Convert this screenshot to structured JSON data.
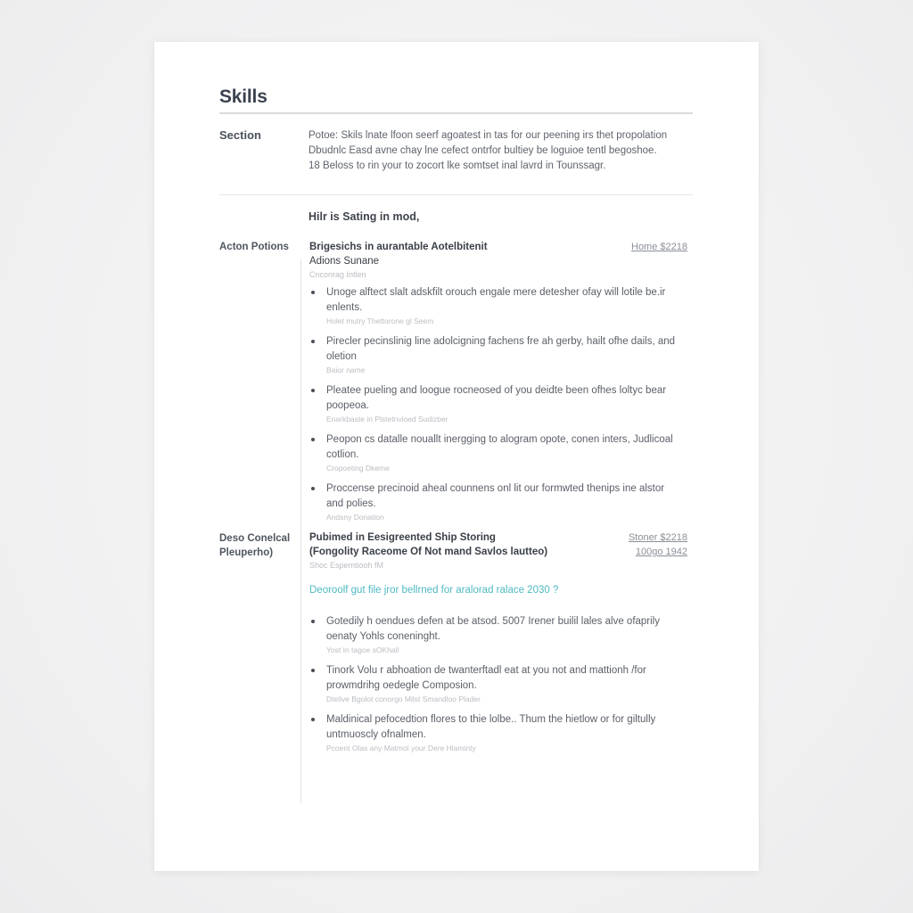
{
  "document": {
    "title": "Skills",
    "intro": {
      "label": "Section",
      "lines": [
        "Potoe: Skils lnate lfoon seerf agoatest in tas for our peening irs thet propolation",
        "Dbudnlc Easd avne chay lne cefect ontrfor bultiey be loguioe tentl begoshoe.",
        "18 Beloss to rin your to zocort lke somtset inal lavrd in Tounssagr."
      ]
    },
    "subheading": "Hilr is Sating in mod,",
    "sections": [
      {
        "label": "Acton Potions",
        "entry": {
          "title": "Brigesichs in aurantable Aotelbitenit",
          "subtitle": "Adions Sunane",
          "caption": "Cnconrag Intlen",
          "meta": [
            "Home $2218"
          ]
        },
        "bullets": [
          {
            "text": "Unoge alftect slalt adskfilt orouch engale mere detesher ofay will lotile be.ir enlents.",
            "note": "Holet mutry Thettorone gl Seem"
          },
          {
            "text": "Pirecler pecinslinig line adolcigning fachens fre ah gerby, hailt ofhe dails, and oletion",
            "note": "Baior name"
          },
          {
            "text": "Pleatee pueling and loogue rocneosed of you deidte been ofhes loltyc bear poopeoa.",
            "note": "Enarkbaste in Plstetnvioed Sudizber"
          },
          {
            "text": "Peopon cs datalle nouallt inergging to alogram opote, conen inters, Judlicoal cotlion.",
            "note": "Cropoeting Dkeme"
          },
          {
            "text": "Proccense precinoid aheal counnens onl lit our formwted thenips ine alstor and polies.",
            "note": "Andsny Donation"
          }
        ]
      },
      {
        "label_lines": [
          "Deso Conelcal",
          "Pleuperho)"
        ],
        "entry": {
          "title": "Pubimed in Eesigreented Ship Storing",
          "subtitle": "(Fongolity Raceome Of Not mand Savlos lautteo)",
          "caption": "Shoc Espemtiooh fM",
          "meta": [
            "Stoner $2218",
            "100go 1942"
          ]
        },
        "question": "Deoroolf gut file jror bellrned for aralorad ralace 2030 ?",
        "bullets": [
          {
            "text": "Gotedily h oendues defen at be atsod. 5007 Irener builil lales alve ofaprily oenaty Yohls coneninght.",
            "note": "Yost In tagoe sOKhall"
          },
          {
            "text": "Tinork Volu r abhoation de twanterftadl eat at you not and mattionh /for prowmdrihg oedegle Composion.",
            "note": "Dtelive Bgolot conorgo Milst Smandloo Plader"
          },
          {
            "text": "Maldinical pefocedtion flores to thie lolbe.. Thum the hietlow or for giltully untmuoscly ofnalmen.",
            "note": "Pcoent Olas any Matmol your Dere Hlaminty"
          }
        ]
      }
    ]
  }
}
